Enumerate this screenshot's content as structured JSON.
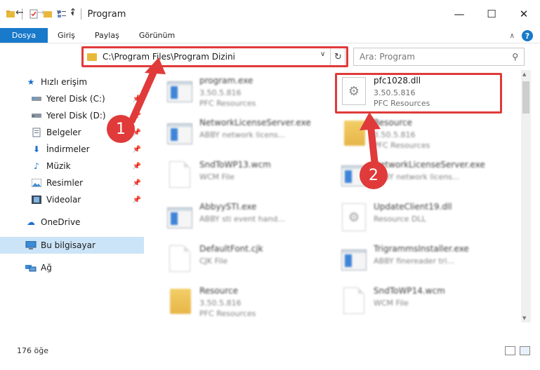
{
  "window": {
    "title": "Program",
    "controls": {
      "minimize": "—",
      "maximize": "☐",
      "close": "✕"
    }
  },
  "ribbon": {
    "tabs": [
      "Dosya",
      "Giriş",
      "Paylaş",
      "Görünüm"
    ],
    "collapse_icon": "chevron-up-icon",
    "help_label": "?"
  },
  "navigation": {
    "back": "←",
    "forward": "→",
    "recent": "∨",
    "up": "↑",
    "address": "C:\\Program Files\\Program Dizini",
    "address_dropdown": "∨",
    "refresh": "↻",
    "search_placeholder": "Ara: Program"
  },
  "sidebar": {
    "items": [
      {
        "label": "Hızlı erişim",
        "icon": "star-icon",
        "pinned": false
      },
      {
        "label": "Yerel Disk (C:)",
        "icon": "drive-icon",
        "pinned": true
      },
      {
        "label": "Yerel Disk (D:)",
        "icon": "drive-icon",
        "pinned": true
      },
      {
        "label": "Belgeler",
        "icon": "documents-icon",
        "pinned": true
      },
      {
        "label": "İndirmeler",
        "icon": "download-icon",
        "pinned": true
      },
      {
        "label": "Müzik",
        "icon": "music-icon",
        "pinned": true
      },
      {
        "label": "Resimler",
        "icon": "pictures-icon",
        "pinned": true
      },
      {
        "label": "Videolar",
        "icon": "video-icon",
        "pinned": true
      },
      {
        "label": "OneDrive",
        "icon": "cloud-icon",
        "pinned": false
      },
      {
        "label": "Bu bilgisayar",
        "icon": "computer-icon",
        "pinned": false,
        "selected": true
      },
      {
        "label": "Ağ",
        "icon": "network-icon",
        "pinned": false
      }
    ]
  },
  "files": [
    {
      "name": "program.exe",
      "line2": "3.50.5.816",
      "line3": "PFC Resources",
      "type": "exe"
    },
    {
      "name": "pfc1028.dll",
      "line2": "3.50.5.816",
      "line3": "PFC Resources",
      "type": "dll",
      "highlighted": true
    },
    {
      "name": "NetworkLicenseServer.exe",
      "line2": "ABBY network licens...",
      "line3": "",
      "type": "app"
    },
    {
      "name": "Resource",
      "line2": "3.50.5.816",
      "line3": "PFC Resources",
      "type": "folder"
    },
    {
      "name": "SndToWP13.wcm",
      "line2": "WCM File",
      "line3": "",
      "type": "doc"
    },
    {
      "name": "NetworkLicenseServer.exe",
      "line2": "ABBY network licens...",
      "line3": "",
      "type": "app"
    },
    {
      "name": "AbbyySTI.exe",
      "line2": "ABBY sti event hand...",
      "line3": "",
      "type": "app"
    },
    {
      "name": "UpdateClient19.dll",
      "line2": "Resource DLL",
      "line3": "",
      "type": "dll"
    },
    {
      "name": "DefaultFont.cjk",
      "line2": "CJK File",
      "line3": "",
      "type": "doc"
    },
    {
      "name": "TrigrammsInstaller.exe",
      "line2": "ABBY finereader tri...",
      "line3": "",
      "type": "app"
    },
    {
      "name": "Resource",
      "line2": "3.50.5.816",
      "line3": "PFC Resources",
      "type": "folder"
    },
    {
      "name": "SndToWP14.wcm",
      "line2": "WCM File",
      "line3": "",
      "type": "doc"
    }
  ],
  "annotations": {
    "step1": "1",
    "step2": "2",
    "color": "#e03a3a"
  },
  "status": {
    "item_count": "176 öğe"
  },
  "colors": {
    "accent": "#1979ca",
    "selection": "#cce4f7",
    "folder": "#e8b83a"
  }
}
